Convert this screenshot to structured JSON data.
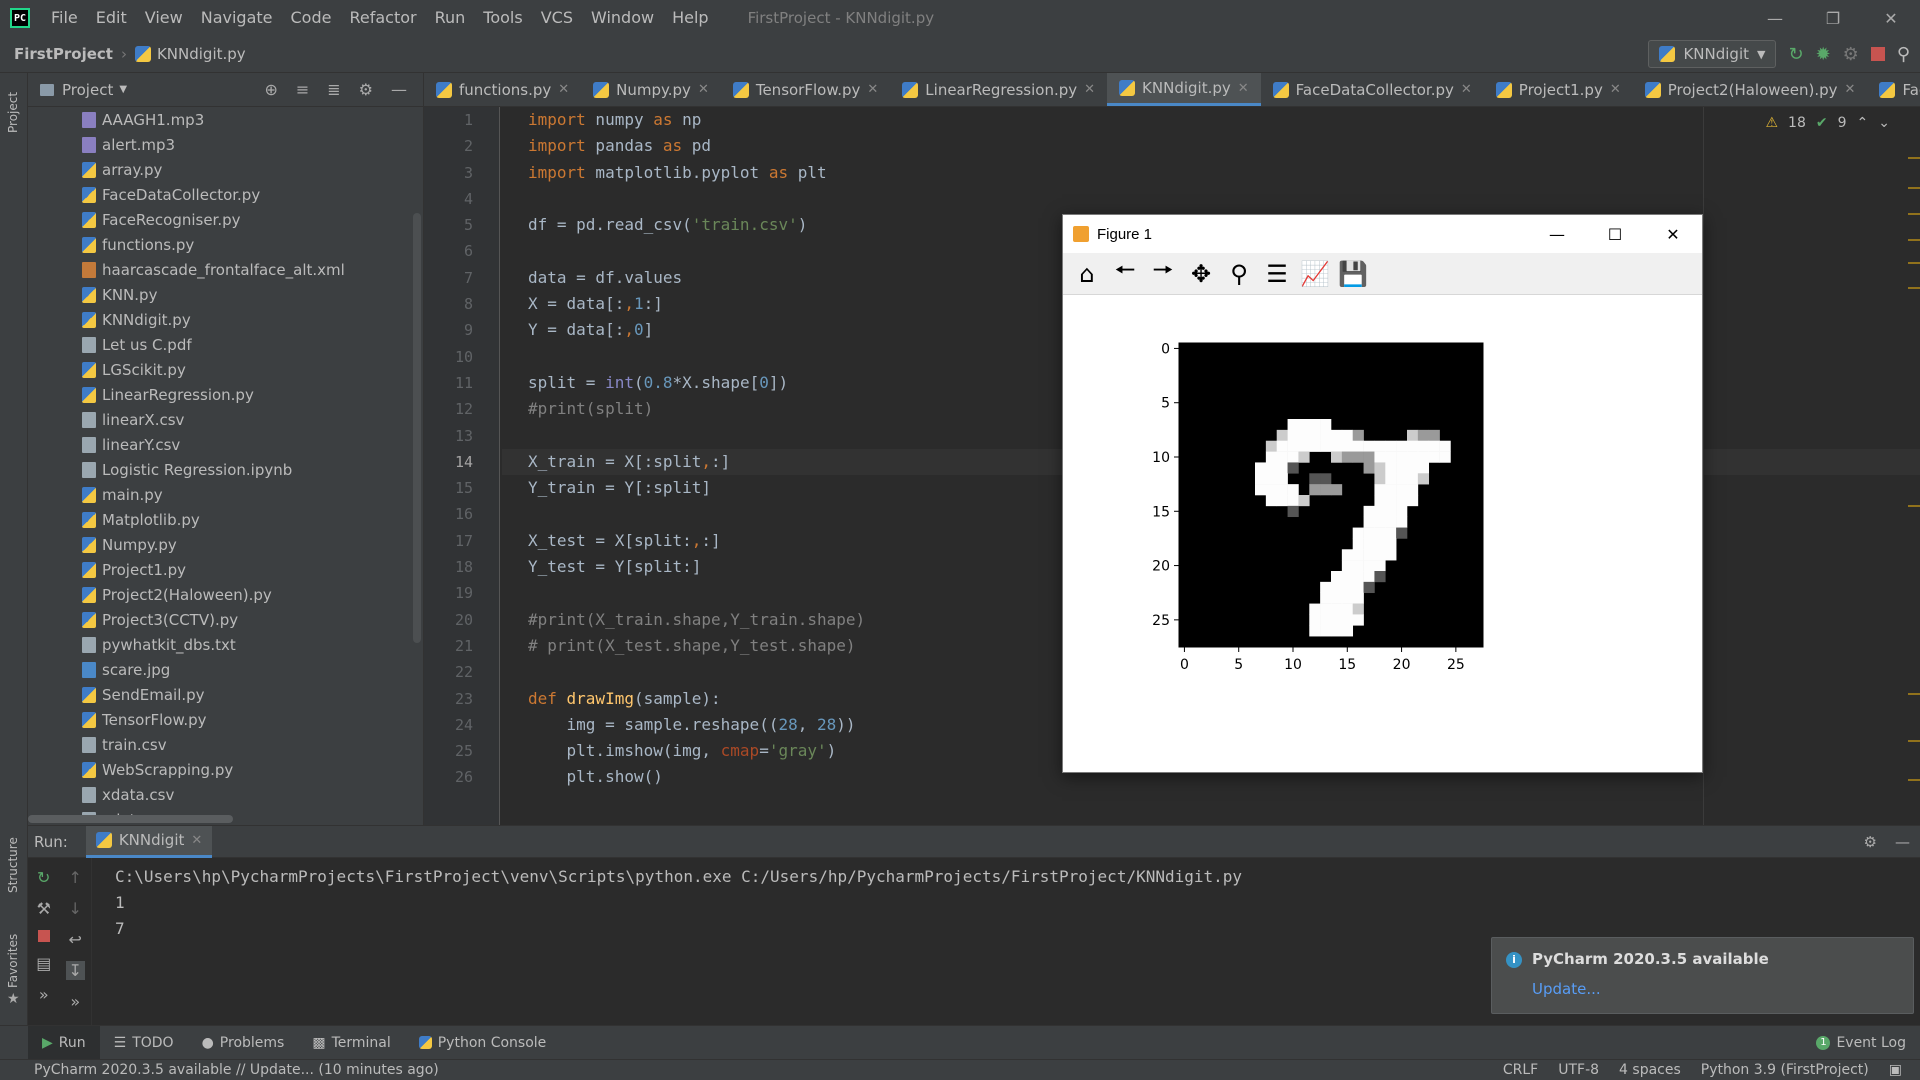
{
  "menubar": {
    "items": [
      "File",
      "Edit",
      "View",
      "Navigate",
      "Code",
      "Refactor",
      "Run",
      "Tools",
      "VCS",
      "Window",
      "Help"
    ],
    "window_title": "FirstProject - KNNdigit.py"
  },
  "navbar": {
    "project": "FirstProject",
    "file": "KNNdigit.py",
    "run_config": "KNNdigit"
  },
  "project_panel": {
    "title": "Project",
    "files": [
      {
        "name": "AAAGH1.mp3",
        "type": "snd"
      },
      {
        "name": "alert.mp3",
        "type": "snd"
      },
      {
        "name": "array.py",
        "type": "py"
      },
      {
        "name": "FaceDataCollector.py",
        "type": "py"
      },
      {
        "name": "FaceRecogniser.py",
        "type": "py"
      },
      {
        "name": "functions.py",
        "type": "py"
      },
      {
        "name": "haarcascade_frontalface_alt.xml",
        "type": "xml"
      },
      {
        "name": "KNN.py",
        "type": "py"
      },
      {
        "name": "KNNdigit.py",
        "type": "py"
      },
      {
        "name": "Let us C.pdf",
        "type": "txt"
      },
      {
        "name": "LGScikit.py",
        "type": "py"
      },
      {
        "name": "LinearRegression.py",
        "type": "py"
      },
      {
        "name": "linearX.csv",
        "type": "txt"
      },
      {
        "name": "linearY.csv",
        "type": "txt"
      },
      {
        "name": "Logistic Regression.ipynb",
        "type": "txt"
      },
      {
        "name": "main.py",
        "type": "py"
      },
      {
        "name": "Matplotlib.py",
        "type": "py"
      },
      {
        "name": "Numpy.py",
        "type": "py"
      },
      {
        "name": "Project1.py",
        "type": "py"
      },
      {
        "name": "Project2(Haloween).py",
        "type": "py"
      },
      {
        "name": "Project3(CCTV).py",
        "type": "py"
      },
      {
        "name": "pywhatkit_dbs.txt",
        "type": "txt"
      },
      {
        "name": "scare.jpg",
        "type": "img"
      },
      {
        "name": "SendEmail.py",
        "type": "py"
      },
      {
        "name": "TensorFlow.py",
        "type": "py"
      },
      {
        "name": "train.csv",
        "type": "txt"
      },
      {
        "name": "WebScrapping.py",
        "type": "py"
      },
      {
        "name": "xdata.csv",
        "type": "txt"
      },
      {
        "name": "ydata.csv",
        "type": "txt"
      }
    ]
  },
  "tabs": [
    {
      "label": "functions.py",
      "active": false
    },
    {
      "label": "Numpy.py",
      "active": false
    },
    {
      "label": "TensorFlow.py",
      "active": false
    },
    {
      "label": "LinearRegression.py",
      "active": false
    },
    {
      "label": "KNNdigit.py",
      "active": true
    },
    {
      "label": "FaceDataCollector.py",
      "active": false
    },
    {
      "label": "Project1.py",
      "active": false
    },
    {
      "label": "Project2(Haloween).py",
      "active": false
    },
    {
      "label": "FaceRecogniser.",
      "active": false
    }
  ],
  "editor": {
    "warnings": "18",
    "weak_warnings": "9",
    "current_line": 14,
    "lines": [
      [
        [
          "kw",
          "import"
        ],
        [
          "",
          " numpy "
        ],
        [
          "kw",
          "as"
        ],
        [
          "",
          " np"
        ]
      ],
      [
        [
          "kw",
          "import"
        ],
        [
          "",
          " pandas "
        ],
        [
          "kw",
          "as"
        ],
        [
          "",
          " pd"
        ]
      ],
      [
        [
          "kw",
          "import"
        ],
        [
          "",
          " matplotlib.pyplot "
        ],
        [
          "kw",
          "as"
        ],
        [
          "",
          " plt"
        ]
      ],
      [],
      [
        [
          "",
          "df = pd.read_csv("
        ],
        [
          "str",
          "'train.csv'"
        ],
        [
          "",
          ")"
        ]
      ],
      [],
      [
        [
          "",
          "data = df.values"
        ]
      ],
      [
        [
          "",
          "X = data[:"
        ],
        [
          "kw",
          ","
        ],
        [
          "num",
          "1"
        ],
        [
          "",
          ":]"
        ]
      ],
      [
        [
          "",
          "Y = data[:"
        ],
        [
          "kw",
          ","
        ],
        [
          "num",
          "0"
        ],
        [
          "",
          "]"
        ]
      ],
      [],
      [
        [
          "",
          "split = "
        ],
        [
          "bi",
          "int"
        ],
        [
          "",
          "("
        ],
        [
          "num",
          "0.8"
        ],
        [
          "",
          "*X.shape["
        ],
        [
          "num",
          "0"
        ],
        [
          "",
          "])"
        ]
      ],
      [
        [
          "cmt",
          "#print(split)"
        ]
      ],
      [],
      [
        [
          "",
          "X_train = X[:split"
        ],
        [
          "kw",
          ","
        ],
        [
          "",
          ":]"
        ]
      ],
      [
        [
          "",
          "Y_train = Y[:split]"
        ]
      ],
      [],
      [
        [
          "",
          "X_test = X[split:"
        ],
        [
          "kw",
          ","
        ],
        [
          "",
          ":]"
        ]
      ],
      [
        [
          "",
          "Y_test = Y[split:]"
        ]
      ],
      [],
      [
        [
          "cmt",
          "#print(X_train.shape,Y_train.shape)"
        ]
      ],
      [
        [
          "cmt",
          "# print(X_test.shape,Y_test.shape)"
        ]
      ],
      [],
      [
        [
          "kw",
          "def "
        ],
        [
          "fn",
          "drawImg"
        ],
        [
          "",
          "(sample):"
        ]
      ],
      [
        [
          "",
          "    img = sample.reshape(("
        ],
        [
          "num",
          "28"
        ],
        [
          "",
          ", "
        ],
        [
          "num",
          "28"
        ],
        [
          "",
          "))"
        ]
      ],
      [
        [
          "",
          "    plt.imshow(img, "
        ],
        [
          "kwarg",
          "cmap"
        ],
        [
          "",
          "="
        ],
        [
          "str",
          "'gray'"
        ],
        [
          "",
          ")"
        ]
      ],
      [
        [
          "",
          "    plt.show()"
        ]
      ]
    ]
  },
  "run_panel": {
    "label": "Run:",
    "tab": "KNNdigit",
    "output": [
      "C:\\Users\\hp\\PycharmProjects\\FirstProject\\venv\\Scripts\\python.exe C:/Users/hp/PycharmProjects/FirstProject/KNNdigit.py",
      "1",
      "7"
    ]
  },
  "notification": {
    "title": "PyCharm 2020.3.5 available",
    "link": "Update..."
  },
  "tool_strip": {
    "run": "Run",
    "todo": "TODO",
    "problems": "Problems",
    "terminal": "Terminal",
    "python_console": "Python Console",
    "event_log": "Event Log",
    "event_log_count": "1"
  },
  "left_strip": {
    "project": "Project",
    "structure": "Structure",
    "favorites": "Favorites"
  },
  "statusbar": {
    "message": "PyCharm 2020.3.5 available // Update... (10 minutes ago)",
    "line_sep": "CRLF",
    "encoding": "UTF-8",
    "indent": "4 spaces",
    "interpreter": "Python 3.9 (FirstProject)"
  },
  "figure": {
    "title": "Figure 1",
    "toolbar": [
      "home-icon",
      "back-icon",
      "forward-icon",
      "pan-icon",
      "zoom-icon",
      "configure-subplots-icon",
      "edit-axis-icon",
      "save-icon"
    ]
  },
  "chart_data": {
    "type": "heatmap",
    "colormap": "gray",
    "size": [
      28,
      28
    ],
    "xticks": [
      0,
      5,
      10,
      15,
      20,
      25
    ],
    "yticks": [
      0,
      5,
      10,
      15,
      20,
      25
    ],
    "xlim": [
      -0.5,
      27.5
    ],
    "ylim": [
      27.5,
      -0.5
    ],
    "grid": false,
    "rows": [
      "............................",
      "............................",
      "............................",
      "............................",
      "............................",
      "............................",
      "............................",
      "..........bbbb..............",
      ".........dbbbbbbc....dcc....",
      "........dbbbbbbbbbbbbbbbb...",
      "........bbbd..dcccbbbbbbb...",
      ".......bbbe......cdbbbb.....",
      ".......bbb..ee....dbbbd.....",
      ".......bbbb.ccc...bbbb......",
      "........bbbd......bbbb......",
      "..........e......bbbb.......",
      ".................bbbb.......",
      "................bbbbe.......",
      "................bbbb........",
      "...............bbbbb........",
      "...............bbbb.........",
      "..............bbbbe.........",
      ".............bbbbe..........",
      ".............bbbb...........",
      "............bbbbd...........",
      "............bbbbb...........",
      "............bbbb............",
      "............................"
    ]
  }
}
